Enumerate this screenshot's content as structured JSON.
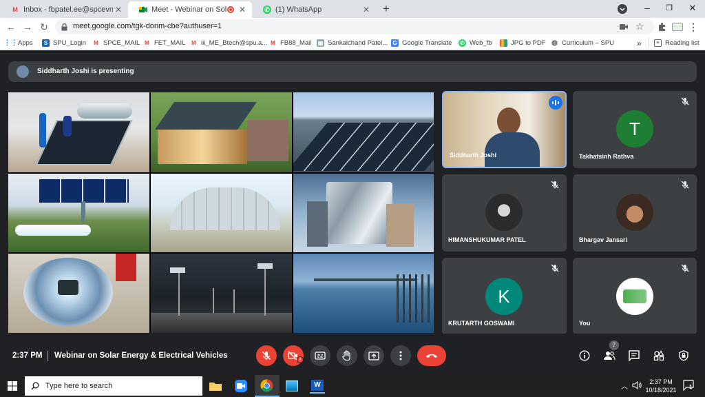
{
  "browser": {
    "tabs": [
      {
        "title": "Inbox - fbpatel.ee@spcevng.ac.in",
        "favicon": "gmail-icon",
        "color": "#ea4335"
      },
      {
        "title": "Meet - Webinar on Solar Ene",
        "favicon": "google-meet-icon",
        "color": "#00832d",
        "recording": true
      },
      {
        "title": "(1) WhatsApp",
        "favicon": "whatsapp-icon",
        "color": "#25d366"
      }
    ],
    "url": "meet.google.com/tgk-donm-cbe?authuser=1",
    "bookmarks": [
      "Apps",
      "SPU_Login",
      "SPCE_MAIL",
      "FET_MAIL",
      "iii_ME_Btech@spu.a...",
      "FB88_Mail",
      "Sankalchand Patel...",
      "Google Translate",
      "Web_fb",
      "JPG to PDF",
      "Curriculum – SPU"
    ],
    "reading_list": "Reading list"
  },
  "meet": {
    "presenting_banner": "Siddharth Joshi is presenting",
    "participants": [
      {
        "name": "Siddharth Joshi",
        "type": "video",
        "speaking": true
      },
      {
        "name": "Takhatsinh Rathva",
        "type": "initial",
        "initial": "T",
        "color": "#1e7e34",
        "muted": true
      },
      {
        "name": "HIMANSHUKUMAR PATEL",
        "type": "photo",
        "muted": true
      },
      {
        "name": "Bhargav Jansari",
        "type": "photo",
        "muted": true
      },
      {
        "name": "KRUTARTH GOSWAMI",
        "type": "initial",
        "initial": "K",
        "color": "#00897b",
        "muted": true
      },
      {
        "name": "You",
        "type": "photo",
        "muted": true
      }
    ],
    "controls": {
      "time": "2:37 PM",
      "meeting_title": "Webinar on Solar Energy & Electrical Vehicles",
      "people_count": "7"
    }
  },
  "taskbar": {
    "search_placeholder": "Type here to search",
    "time": "2:37 PM",
    "date": "10/18/2021",
    "notifications": "1"
  }
}
